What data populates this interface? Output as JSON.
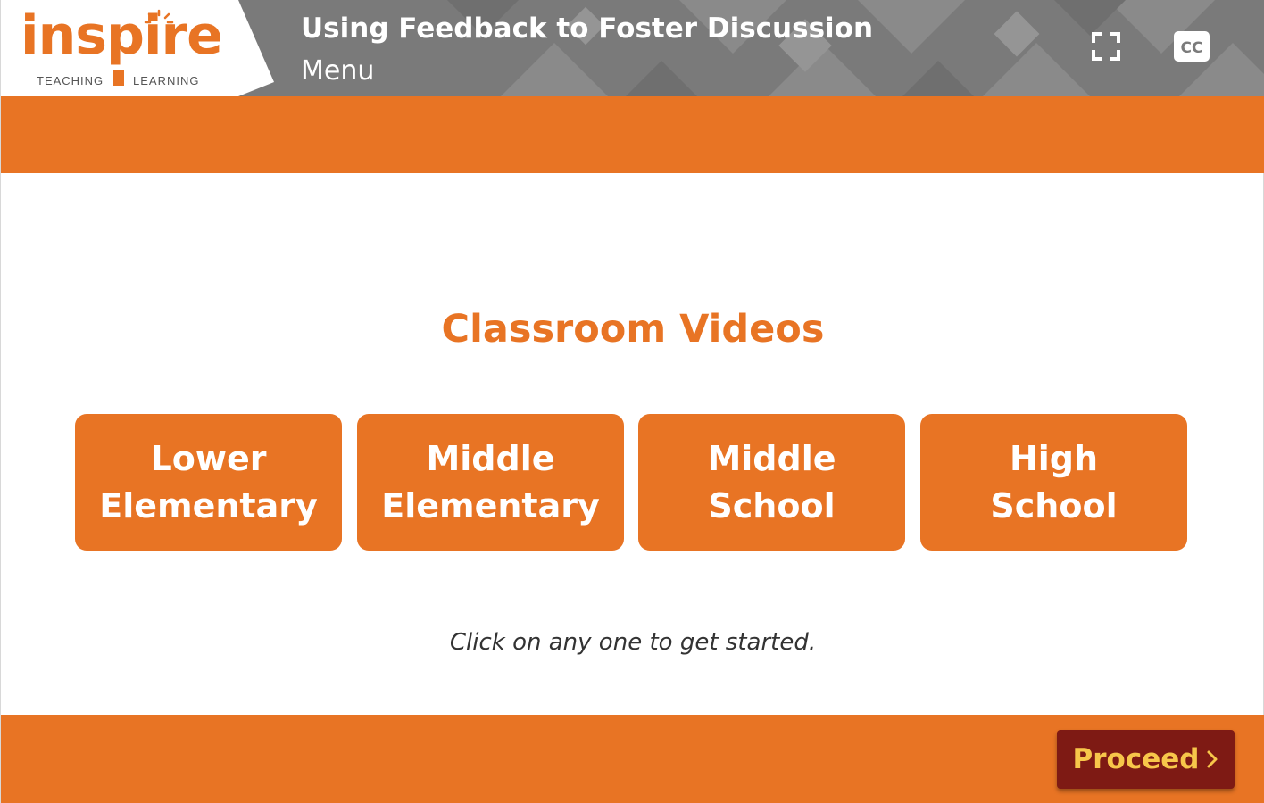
{
  "header": {
    "logo": {
      "wordmark": "inspire",
      "tagline_left": "TEACHING",
      "tagline_right": "LEARNING"
    },
    "title": "Using Feedback to Foster Discussion",
    "subtitle": "Menu",
    "controls": {
      "fullscreen_icon": "fullscreen-icon",
      "cc_label": "CC",
      "cc_icon": "closed-captions-icon"
    }
  },
  "main": {
    "heading": "Classroom Videos",
    "buttons": [
      {
        "line1": "Lower",
        "line2": "Elementary"
      },
      {
        "line1": "Middle",
        "line2": "Elementary"
      },
      {
        "line1": "Middle",
        "line2": "School"
      },
      {
        "line1": "High",
        "line2": "School"
      }
    ],
    "instruction": "Click on any one to get started."
  },
  "footer": {
    "proceed_label": "Proceed",
    "proceed_icon": "chevron-right-icon"
  },
  "colors": {
    "brand_orange": "#e87424",
    "header_gray": "#7b7b7b",
    "proceed_bg": "#7e1a14",
    "proceed_text": "#f7c64a"
  }
}
